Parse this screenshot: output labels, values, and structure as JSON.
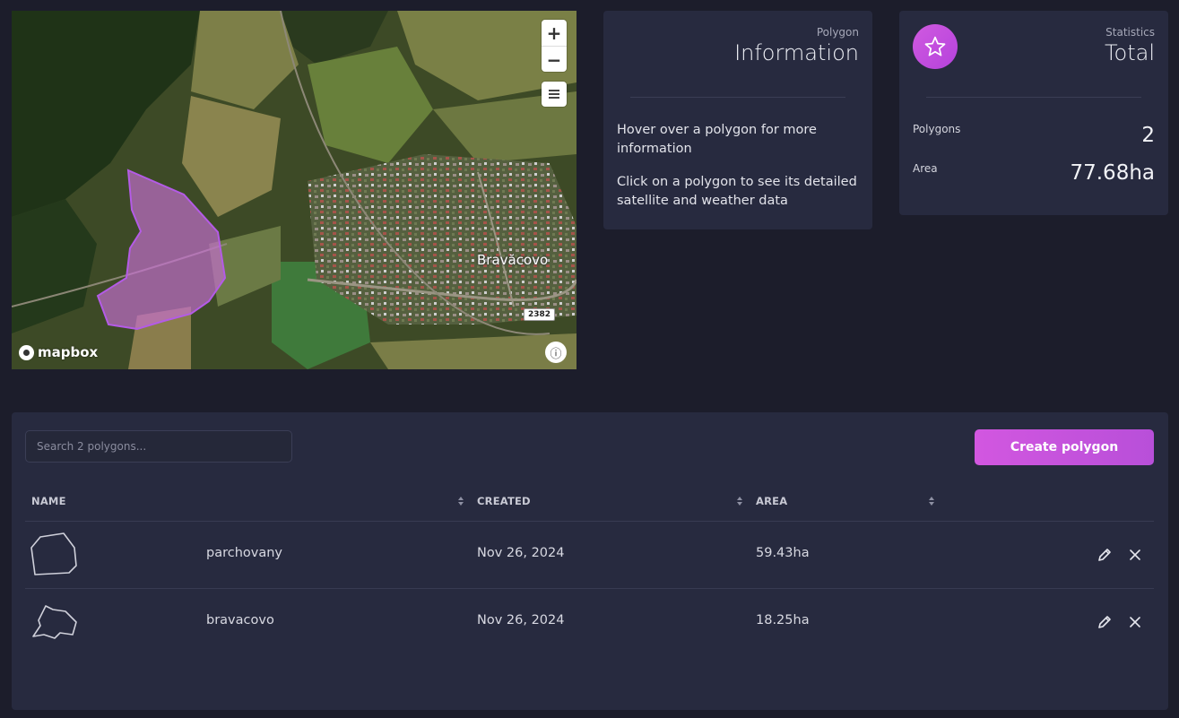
{
  "map": {
    "place_label": "Bravăcovo",
    "road_number": "2382",
    "attribution": "mapbox",
    "zoom_in": "+",
    "zoom_out": "−",
    "polygon_color": "#c96fd6"
  },
  "info_card": {
    "subtitle": "Polygon",
    "title": "Information",
    "hint_hover": "Hover over a polygon for more information",
    "hint_click": "Click on a polygon to see its detailed satellite and weather data"
  },
  "stats_card": {
    "subtitle": "Statistics",
    "title": "Total",
    "polygons_label": "Polygons",
    "polygons_value": "2",
    "area_label": "Area",
    "area_value": "77.68ha",
    "icon": "star-icon",
    "accent": "#c450de"
  },
  "table": {
    "search_placeholder": "Search 2 polygons...",
    "create_label": "Create polygon",
    "headers": {
      "name": "NAME",
      "created": "CREATED",
      "area": "AREA"
    },
    "rows": [
      {
        "name": "parchovany",
        "created": "Nov 26, 2024",
        "area": "59.43ha"
      },
      {
        "name": "bravacovo",
        "created": "Nov 26, 2024",
        "area": "18.25ha"
      }
    ]
  }
}
